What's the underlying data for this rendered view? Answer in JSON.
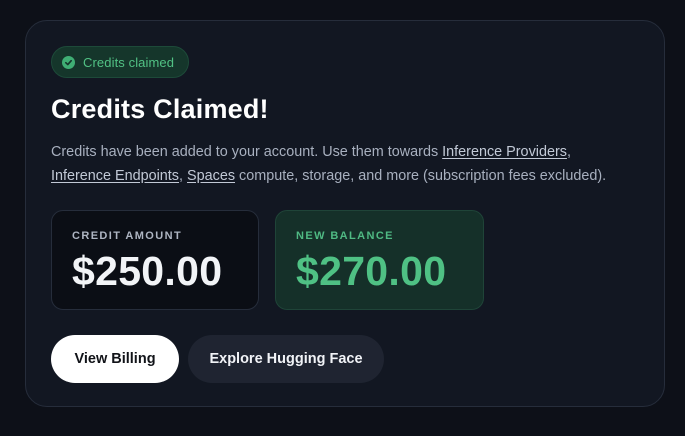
{
  "badge": {
    "label": "Credits claimed",
    "color": "#51c184",
    "icon": "check-circle-icon"
  },
  "title": "Credits Claimed!",
  "description": {
    "text_1": "Credits have been added to your account. Use them towards ",
    "link_1": "Inference Providers",
    "text_2": ", ",
    "link_2": "Inference Endpoints",
    "text_3": ", ",
    "link_3": "Spaces",
    "text_4": " compute, storage, and more (subscription fees excluded)."
  },
  "stats": {
    "credit": {
      "label": "CREDIT AMOUNT",
      "value": "$250.00"
    },
    "balance": {
      "label": "NEW BALANCE",
      "value": "$270.00",
      "color": "#4fc184"
    }
  },
  "actions": {
    "primary_label": "View Billing",
    "secondary_label": "Explore Hugging Face"
  }
}
